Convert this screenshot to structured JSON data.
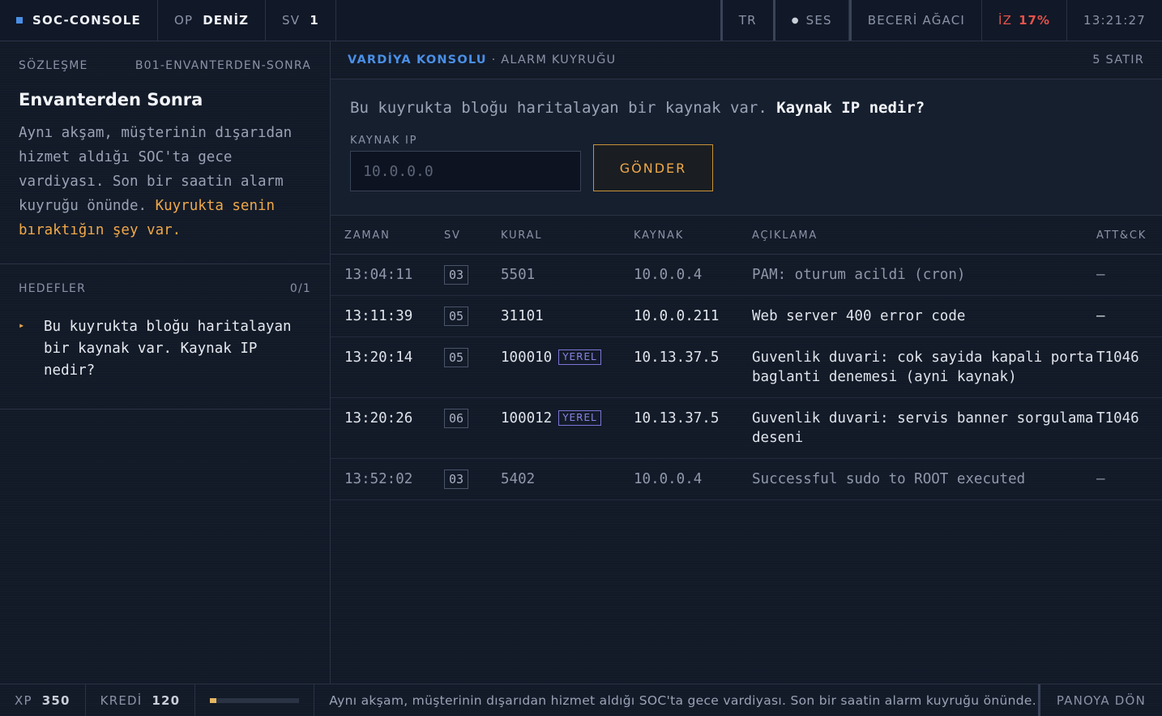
{
  "topbar": {
    "brand": "SOC-CONSOLE",
    "op_label": "OP",
    "op_value": "DENİZ",
    "sv_label": "SV",
    "sv_value": "1",
    "lang": "TR",
    "sound": "SES",
    "skill_tree": "BECERİ AĞACI",
    "trace_label": "İZ",
    "trace_value": "17%",
    "clock": "13:21:27"
  },
  "contract": {
    "label": "SÖZLEŞME",
    "code": "B01-ENVANTERDEN-SONRA",
    "title": "Envanterden Sonra",
    "body": "Aynı akşam, müşterinin dışarıdan hizmet aldığı SOC'ta gece vardiyası. Son bir saatin alarm kuyruğu önünde. ",
    "body_highlight": "Kuyrukta senin bıraktığın şey var."
  },
  "goals": {
    "label": "HEDEFLER",
    "count": "0/1",
    "items": [
      {
        "text": "Bu kuyrukta bloğu haritalayan bir kaynak var. Kaynak IP nedir?"
      }
    ]
  },
  "main": {
    "title": "VARDİYA KONSOLU",
    "subtitle": "· ALARM KUYRUĞU",
    "row_count": "5 SATIR",
    "question_prefix": "Bu kuyrukta bloğu haritalayan bir kaynak var. ",
    "question_bold": "Kaynak IP nedir?",
    "input_label": "KAYNAK IP",
    "input_placeholder": "10.0.0.0",
    "submit": "GÖNDER"
  },
  "table": {
    "headers": {
      "time": "ZAMAN",
      "sv": "SV",
      "rule": "KURAL",
      "source": "KAYNAK",
      "desc": "AÇIKLAMA",
      "attack": "ATT&CK"
    },
    "rows": [
      {
        "time": "13:04:11",
        "sv": "03",
        "rule": "5501",
        "tag": "",
        "source": "10.0.0.4",
        "desc": "PAM: oturum acildi (cron)",
        "attack": "—"
      },
      {
        "time": "13:11:39",
        "sv": "05",
        "rule": "31101",
        "tag": "",
        "source": "10.0.0.211",
        "desc": "Web server 400 error code",
        "attack": "—"
      },
      {
        "time": "13:20:14",
        "sv": "05",
        "rule": "100010",
        "tag": "YEREL",
        "source": "10.13.37.5",
        "desc": "Guvenlik duvari: cok sayida kapali porta baglanti denemesi (ayni kaynak)",
        "attack": "T1046"
      },
      {
        "time": "13:20:26",
        "sv": "06",
        "rule": "100012",
        "tag": "YEREL",
        "source": "10.13.37.5",
        "desc": "Guvenlik duvari: servis banner sorgulama deseni",
        "attack": "T1046"
      },
      {
        "time": "13:52:02",
        "sv": "03",
        "rule": "5402",
        "tag": "",
        "source": "10.0.0.4",
        "desc": "Successful sudo to ROOT executed",
        "attack": "—"
      }
    ]
  },
  "footer": {
    "xp_label": "XP",
    "xp_value": "350",
    "credit_label": "KREDİ",
    "credit_value": "120",
    "progress": 0.07,
    "ticker": "Aynı akşam, müşterinin dışarıdan hizmet aldığı SOC'ta gece vardiyası. Son bir saatin alarm kuyruğu önünde. K...",
    "back": "PANOYA DÖN"
  },
  "colors": {
    "accent": "#4a8fe6",
    "warning": "#f0a848",
    "danger": "#e4534a",
    "attack": "#8c84e6"
  }
}
